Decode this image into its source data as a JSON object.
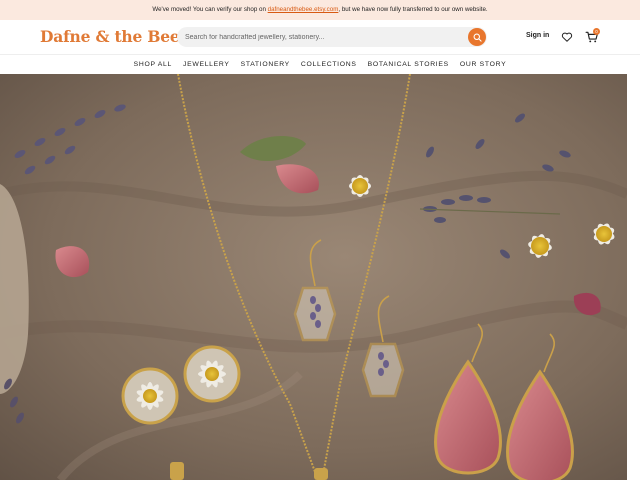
{
  "announcement": {
    "prefix": "We've moved! You can verify our shop on ",
    "link": "dafneandthebee.etsy.com",
    "suffix": ", but we have now fully transferred to our own website."
  },
  "header": {
    "logo": "Dafne & the Bee",
    "search_placeholder": "Search for handcrafted jewellery, stationery...",
    "sign_in": "Sign in",
    "cart_count": "0"
  },
  "nav": {
    "items": [
      "SHOP ALL",
      "JEWELLERY",
      "STATIONERY",
      "COLLECTIONS",
      "BOTANICAL STORIES",
      "OUR STORY"
    ]
  },
  "colors": {
    "brand": "#e07a36",
    "announcement_bg": "#fbe9df",
    "link": "#d85a12"
  },
  "icons": {
    "search": "search-icon",
    "wishlist": "heart-icon",
    "cart": "cart-icon"
  }
}
